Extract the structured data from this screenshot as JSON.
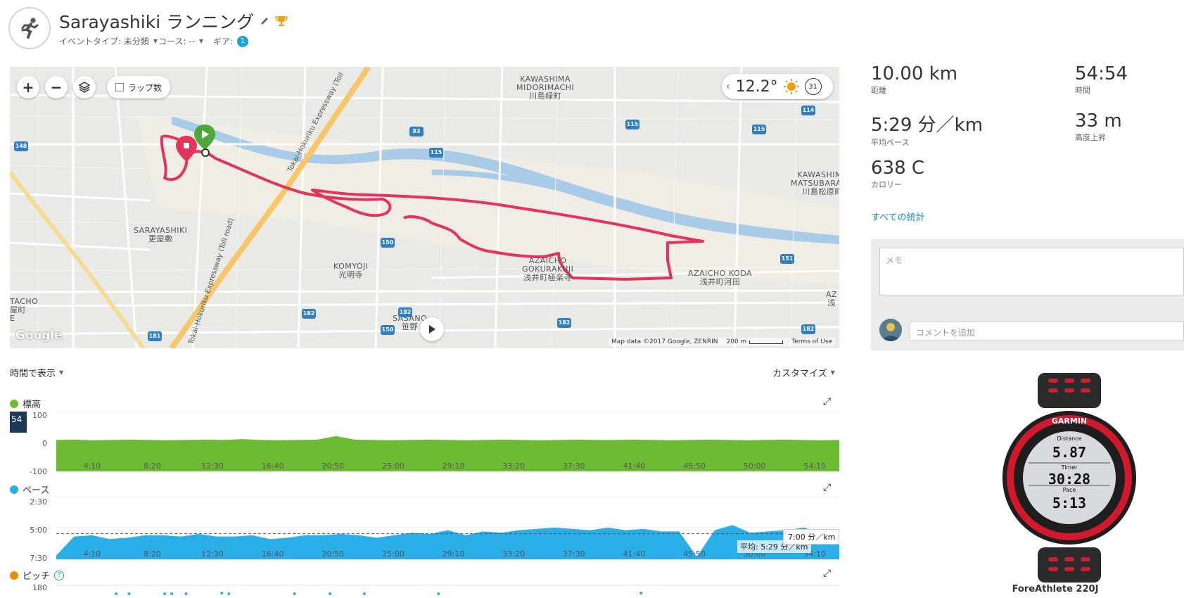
{
  "activity": {
    "title": "Sarayashiki ランニング",
    "event_type": "イベントタイプ: 未分類",
    "course": "コース: --",
    "gear_label": "ギア:",
    "gear_count": "1"
  },
  "map": {
    "zoom_in": "+",
    "zoom_out": "−",
    "lap_label": "ラップ数",
    "temperature": "12.2°",
    "date_badge": "31",
    "labels": [
      {
        "text": "KAWASHIMA\nMIDORIMACHI\n川島緑町"
      },
      {
        "text": "SARAYASHIKI\n更屋敷"
      },
      {
        "text": "KOMYOJI\n光明寺"
      },
      {
        "text": "AZAICHO\nGOKURAKUJI\n浅井町極楽寺"
      },
      {
        "text": "AZAICHO KODA\n浅井町河田"
      },
      {
        "text": "KAWASHIMA\nMATSUBARAMA\n川島松原町"
      },
      {
        "text": "SASANO\n笹野"
      },
      {
        "text": "TACHO\n屋町\nE"
      },
      {
        "text": "AZ\n浅"
      }
    ],
    "routes": [
      "Tokai-Hokuriku Expressway (Toll",
      "Tokai-Hokuriku Expressway (Toll road)"
    ],
    "route_numbers": [
      "148",
      "93",
      "115",
      "115",
      "115",
      "114",
      "150",
      "150",
      "151",
      "182",
      "182",
      "182",
      "182",
      "181"
    ],
    "google": "Google",
    "footer": {
      "data": "Map data ©2017 Google, ZENRIN",
      "scale": "200 m",
      "terms": "Terms of Use"
    }
  },
  "stats": {
    "distance": {
      "value": "10.00 km",
      "label": "距離"
    },
    "time": {
      "value": "54:54",
      "label": "時間"
    },
    "pace": {
      "value": "5:29 分／km",
      "label": "平均ペース"
    },
    "elev": {
      "value": "33 m",
      "label": "高度上昇"
    },
    "calories": {
      "value": "638 C",
      "label": "カロリー"
    },
    "all_stats": "すべての統計"
  },
  "comments": {
    "memo_placeholder": "メモ",
    "comment_placeholder": "コメントを追加"
  },
  "device": {
    "name": "ForeAthlete 220J",
    "brand": "GARMIN",
    "rows": [
      {
        "label": "Distance",
        "value": "5.87"
      },
      {
        "label": "Timer",
        "value": "30:28"
      },
      {
        "label": "Pace",
        "value": "5:13"
      }
    ]
  },
  "charts_header": {
    "display_by": "時間で表示",
    "customize": "カスタマイズ"
  },
  "chart_data": [
    {
      "type": "area",
      "title": "標高",
      "color": "#6dbb34",
      "ylim": [
        -100,
        100
      ],
      "yticks": [
        "100",
        "0",
        "-100"
      ],
      "cursor_label": "54",
      "x": [
        "4:10",
        "8:20",
        "12:30",
        "16:40",
        "20:50",
        "25:00",
        "29:10",
        "33:20",
        "37:30",
        "41:40",
        "45:50",
        "50:00",
        "54:10"
      ],
      "values": [
        5,
        6,
        4,
        5,
        6,
        5,
        4,
        5,
        6,
        5,
        8,
        5,
        4,
        5,
        6,
        18,
        6,
        5,
        4,
        5,
        6,
        5,
        4,
        5,
        6,
        5,
        4,
        5,
        6,
        5,
        5,
        6,
        5,
        4,
        5,
        6,
        5,
        4,
        5,
        6,
        5,
        4,
        5
      ]
    },
    {
      "type": "area",
      "title": "ペース",
      "color": "#2aaee8",
      "y_reversed": true,
      "ylim": [
        7.5,
        2.5
      ],
      "yticks": [
        "2:30",
        "5:00",
        "7:30"
      ],
      "average": 5.48,
      "average_label": "平均: 5:29 分／km",
      "tooltip": "7:00 分／km",
      "x": [
        "4:10",
        "8:20",
        "12:30",
        "16:40",
        "20:50",
        "25:00",
        "29:10",
        "33:20",
        "37:30",
        "41:40",
        "45:50",
        "50:00",
        "54:10"
      ],
      "values": [
        7.2,
        5.7,
        5.6,
        5.9,
        5.8,
        5.6,
        5.6,
        5.7,
        5.5,
        5.7,
        5.7,
        5.6,
        5.9,
        5.8,
        5.6,
        5.6,
        5.5,
        5.6,
        5.8,
        5.6,
        5.4,
        5.5,
        5.2,
        5.6,
        5.3,
        5.4,
        5.2,
        5.1,
        5.0,
        5.1,
        5.2,
        5.0,
        5.2,
        5.1,
        5.3,
        5.3,
        7.3,
        5.2,
        4.8,
        5.4,
        5.3,
        5.2,
        5.0,
        5.4,
        6.2
      ]
    },
    {
      "type": "scatter",
      "title": "ピッチ",
      "color": "#f08a00",
      "yticks": [
        "180"
      ],
      "x_points": [
        4.2,
        5.1,
        7.6,
        8.1,
        9.1,
        11.6,
        12.1,
        16.7,
        19.2,
        21.6,
        26.8,
        41.0
      ],
      "values": [
        168,
        168,
        168,
        168,
        168,
        169,
        168,
        168,
        168,
        168,
        168,
        169
      ]
    }
  ]
}
